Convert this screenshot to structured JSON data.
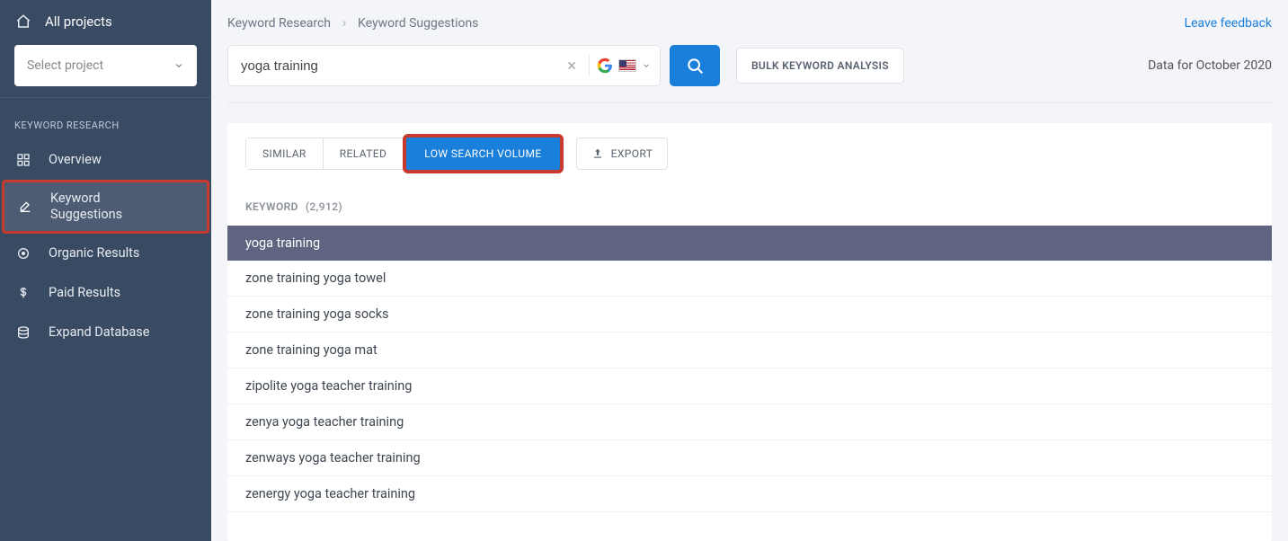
{
  "sidebar": {
    "all_projects": "All projects",
    "select_placeholder": "Select project",
    "section_title": "KEYWORD RESEARCH",
    "items": [
      {
        "label": "Overview"
      },
      {
        "label_line1": "Keyword",
        "label_line2": "Suggestions"
      },
      {
        "label": "Organic Results"
      },
      {
        "label": "Paid Results"
      },
      {
        "label": "Expand Database"
      }
    ]
  },
  "breadcrumb": {
    "root": "Keyword Research",
    "current": "Keyword Suggestions"
  },
  "feedback": "Leave feedback",
  "search": {
    "value": "yoga training"
  },
  "bulk_label": "BULK KEYWORD ANALYSIS",
  "data_date": "Data for October 2020",
  "tabs": {
    "similar": "SIMILAR",
    "related": "RELATED",
    "lowvol": "LOW SEARCH VOLUME"
  },
  "export_label": "EXPORT",
  "list": {
    "header": "KEYWORD",
    "count": "(2,912)",
    "rows": [
      "yoga training",
      "zone training yoga towel",
      "zone training yoga socks",
      "zone training yoga mat",
      "zipolite yoga teacher training",
      "zenya yoga teacher training",
      "zenways yoga teacher training",
      "zenergy yoga teacher training"
    ]
  }
}
